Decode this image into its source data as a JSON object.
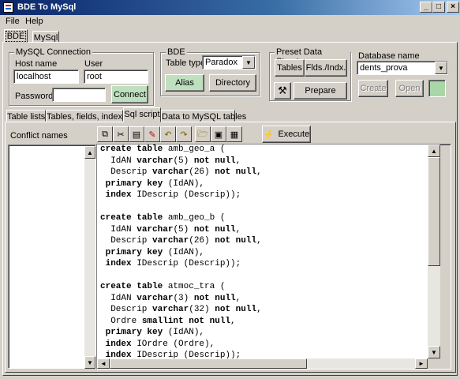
{
  "window": {
    "title": "BDE To MySql"
  },
  "menu": [
    "File",
    "Help"
  ],
  "top_tabs": [
    "BDE",
    "MySql"
  ],
  "mysql": {
    "group_title": "MySQL Connection",
    "host_label": "Host name",
    "host_value": "localhost",
    "user_label": "User",
    "user_value": "root",
    "password_label": "Password",
    "password_value": "",
    "connect_label": "Connect"
  },
  "bde": {
    "group_title": "BDE",
    "table_type_label": "Table type",
    "table_type_value": "Paradox",
    "alias_label": "Alias",
    "directory_label": "Directory"
  },
  "preset": {
    "group_title": "Preset Data Structure",
    "tables_label": "Tables",
    "flds_label": "Flds./Indx.",
    "prepare_label": "Prepare"
  },
  "database": {
    "label": "Database name",
    "value": "dents_prova",
    "create_label": "Create",
    "open_label": "Open"
  },
  "sub_tabs": [
    "Table lists",
    "Tables, fields, indexes",
    "Sql script",
    "Data to MySQL tables"
  ],
  "conflict_label": "Conflict names",
  "execute_label": "Execute",
  "toolbar_icons": [
    "copy-icon",
    "cut-icon",
    "paste-icon",
    "erase-icon",
    "undo-icon",
    "redo-icon",
    "open-folder-icon",
    "save-icon",
    "save-as-icon"
  ],
  "sql_lines": [
    [
      {
        "t": "create table",
        "b": true
      },
      {
        "t": " amb_geo_a (",
        "b": false
      }
    ],
    [
      {
        "t": "  IdAN ",
        "b": false
      },
      {
        "t": "varchar",
        "b": true
      },
      {
        "t": "(5) ",
        "b": false
      },
      {
        "t": "not null",
        "b": true
      },
      {
        "t": ",",
        "b": false
      }
    ],
    [
      {
        "t": "  Descrip ",
        "b": false
      },
      {
        "t": "varchar",
        "b": true
      },
      {
        "t": "(26) ",
        "b": false
      },
      {
        "t": "not null",
        "b": true
      },
      {
        "t": ",",
        "b": false
      }
    ],
    [
      {
        "t": " primary key",
        "b": true
      },
      {
        "t": " (IdAN),",
        "b": false
      }
    ],
    [
      {
        "t": " index",
        "b": true
      },
      {
        "t": " IDescrip (Descrip));",
        "b": false
      }
    ],
    [
      {
        "t": "",
        "b": false
      }
    ],
    [
      {
        "t": "create table",
        "b": true
      },
      {
        "t": " amb_geo_b (",
        "b": false
      }
    ],
    [
      {
        "t": "  IdAN ",
        "b": false
      },
      {
        "t": "varchar",
        "b": true
      },
      {
        "t": "(5) ",
        "b": false
      },
      {
        "t": "not null",
        "b": true
      },
      {
        "t": ",",
        "b": false
      }
    ],
    [
      {
        "t": "  Descrip ",
        "b": false
      },
      {
        "t": "varchar",
        "b": true
      },
      {
        "t": "(26) ",
        "b": false
      },
      {
        "t": "not null",
        "b": true
      },
      {
        "t": ",",
        "b": false
      }
    ],
    [
      {
        "t": " primary key",
        "b": true
      },
      {
        "t": " (IdAN),",
        "b": false
      }
    ],
    [
      {
        "t": " index",
        "b": true
      },
      {
        "t": " IDescrip (Descrip));",
        "b": false
      }
    ],
    [
      {
        "t": "",
        "b": false
      }
    ],
    [
      {
        "t": "create table",
        "b": true
      },
      {
        "t": " atmoc_tra (",
        "b": false
      }
    ],
    [
      {
        "t": "  IdAN ",
        "b": false
      },
      {
        "t": "varchar",
        "b": true
      },
      {
        "t": "(3) ",
        "b": false
      },
      {
        "t": "not null",
        "b": true
      },
      {
        "t": ",",
        "b": false
      }
    ],
    [
      {
        "t": "  Descrip ",
        "b": false
      },
      {
        "t": "varchar",
        "b": true
      },
      {
        "t": "(32) ",
        "b": false
      },
      {
        "t": "not null",
        "b": true
      },
      {
        "t": ",",
        "b": false
      }
    ],
    [
      {
        "t": "  Ordre ",
        "b": false
      },
      {
        "t": "smallint not null",
        "b": true
      },
      {
        "t": ",",
        "b": false
      }
    ],
    [
      {
        "t": " primary key",
        "b": true
      },
      {
        "t": " (IdAN),",
        "b": false
      }
    ],
    [
      {
        "t": " index",
        "b": true
      },
      {
        "t": " IOrdre (Ordre),",
        "b": false
      }
    ],
    [
      {
        "t": " index",
        "b": true
      },
      {
        "t": " IDescrip (Descrip));",
        "b": false
      }
    ]
  ]
}
